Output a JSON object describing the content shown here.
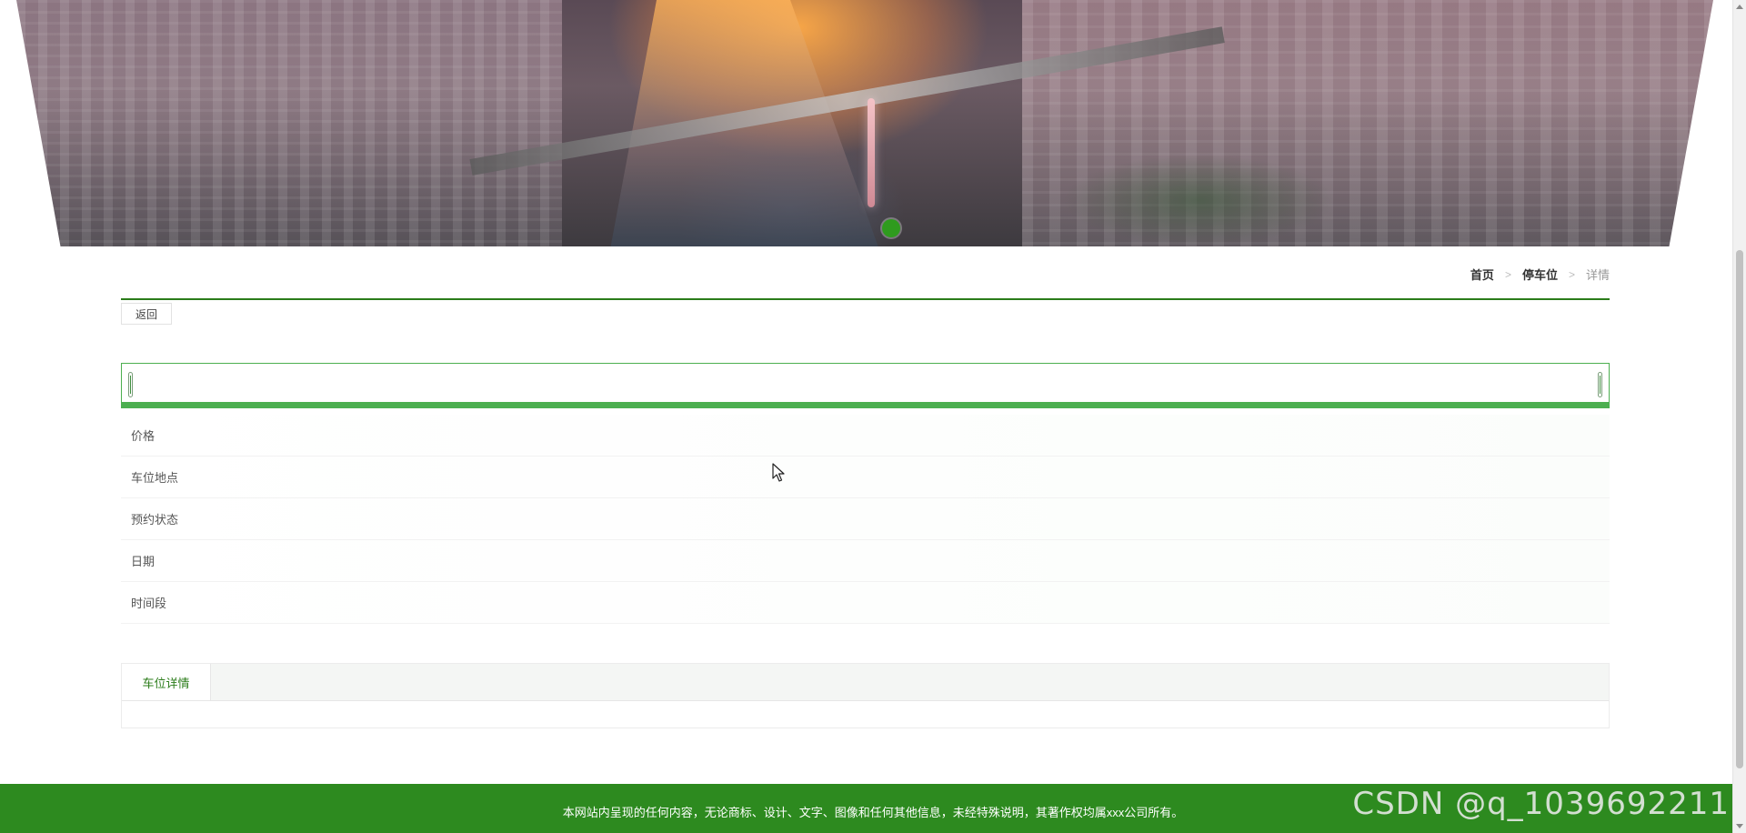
{
  "banner": {
    "alt": "city-river-bridge-banner",
    "active_slide": 1,
    "slide_count": 1
  },
  "breadcrumb": {
    "home": "首页",
    "category": "停车位",
    "current": "详情",
    "separator": ">"
  },
  "actions": {
    "back_label": "返回"
  },
  "slider": {
    "accent_color": "#4caf50"
  },
  "details": {
    "fields": [
      {
        "label": "价格",
        "value": ""
      },
      {
        "label": "车位地点",
        "value": ""
      },
      {
        "label": "预约状态",
        "value": ""
      },
      {
        "label": "日期",
        "value": ""
      },
      {
        "label": "时间段",
        "value": ""
      }
    ]
  },
  "tabs": {
    "items": [
      {
        "label": "车位详情"
      }
    ],
    "content": ""
  },
  "footer": {
    "copyright": "本网站内呈现的任何内容，无论商标、设计、文字、图像和任何其他信息，未经特殊说明，其著作权均属xxx公司所有。",
    "background_color": "#2d8a1f"
  },
  "watermark": {
    "text": "CSDN @q_1039692211"
  },
  "theme": {
    "primary_green": "#2b7c1a",
    "slider_green": "#4caf50"
  }
}
